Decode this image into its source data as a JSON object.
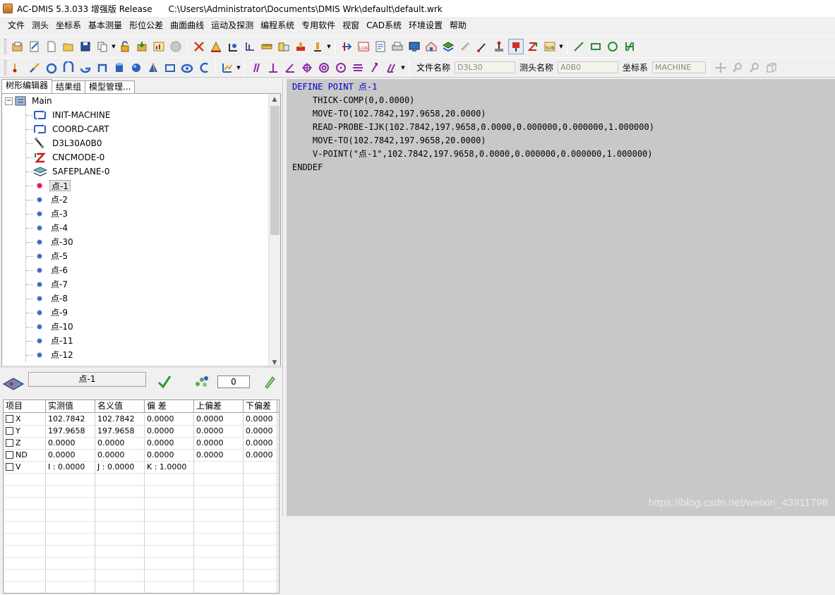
{
  "window": {
    "title": "AC-DMIS 5.3.033 增强版 Release      C:\\Users\\Administrator\\Documents\\DMIS Wrk\\default\\default.wrk"
  },
  "menu": [
    "文件",
    "测头",
    "坐标系",
    "基本测量",
    "形位公差",
    "曲面曲线",
    "运动及探测",
    "编程系统",
    "专用软件",
    "视窗",
    "CAD系统",
    "环境设置",
    "帮助"
  ],
  "toolbar_fields": {
    "file_label": "文件名称",
    "file_value": "D3L30",
    "probe_label": "测头名称",
    "probe_value": "A0B0",
    "coord_label": "坐标系",
    "coord_value": "MACHINE"
  },
  "tabs": [
    "树形编辑器",
    "结果组",
    "模型管理..."
  ],
  "tree": {
    "root": "Main",
    "setup_nodes": [
      "INIT-MACHINE",
      "COORD-CART",
      "D3L30A0B0",
      "CNCMODE-0",
      "SAFEPLANE-0"
    ],
    "points": [
      "点-1",
      "点-2",
      "点-3",
      "点-4",
      "点-30",
      "点-5",
      "点-6",
      "点-7",
      "点-8",
      "点-9",
      "点-10",
      "点-11",
      "点-12"
    ],
    "selected": "点-1"
  },
  "result": {
    "feature_name": "点-1",
    "count": "0",
    "columns": [
      "项目",
      "实测值",
      "名义值",
      "偏 差",
      "上偏差",
      "下偏差"
    ],
    "rows": [
      [
        "X",
        "102.7842",
        "102.7842",
        "0.0000",
        "0.0000",
        "0.0000"
      ],
      [
        "Y",
        "197.9658",
        "197.9658",
        "0.0000",
        "0.0000",
        "0.0000"
      ],
      [
        "Z",
        "0.0000",
        "0.0000",
        "0.0000",
        "0.0000",
        "0.0000"
      ],
      [
        "ND",
        "0.0000",
        "0.0000",
        "0.0000",
        "0.0000",
        "0.0000"
      ],
      [
        "V",
        "I : 0.0000",
        "J : 0.0000",
        "K : 1.0000",
        "",
        ""
      ]
    ]
  },
  "editor": {
    "lines": [
      "DEFINE POINT 点-1",
      "    THICK-COMP(0,0.0000)",
      "    MOVE-TO(102.7842,197.9658,20.0000)",
      "    READ-PROBE-IJK(102.7842,197.9658,0.0000,0.000000,0.000000,1.000000)",
      "    MOVE-TO(102.7842,197.9658,20.0000)",
      "    V-POINT(\"点-1\",102.7842,197.9658,0.0000,0.000000,0.000000,1.000000)",
      "ENDDEF"
    ]
  },
  "watermark": "https://blog.csdn.net/weixin_43911798",
  "colors": {
    "editor_bg": "#c8c8c8",
    "keyword": "#0000cc",
    "point_icon": "#3a66c4",
    "selected_point_icon": "#e02020"
  }
}
